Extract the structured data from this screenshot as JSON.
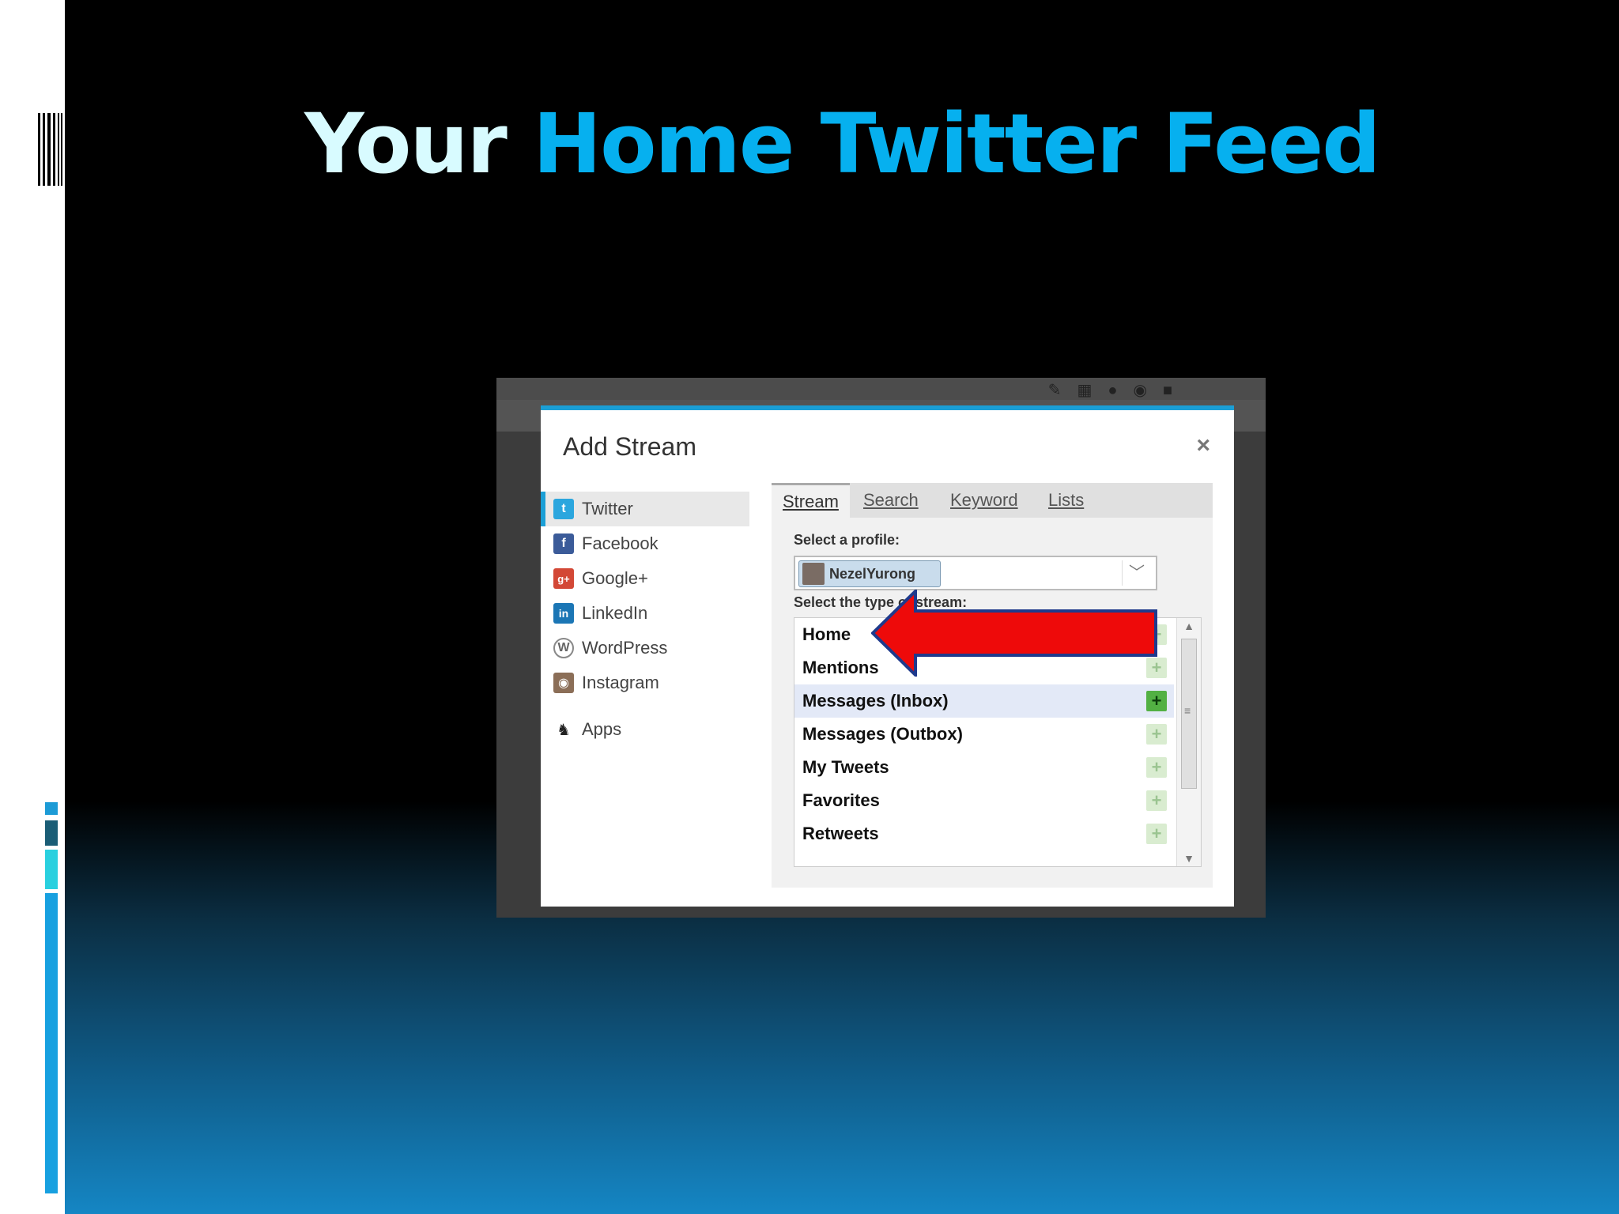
{
  "slide": {
    "title_part1": "Your",
    "title_part2": "Home Twitter Feed",
    "colors": {
      "title_part1": "#d8fbff",
      "title_part2": "#06b0ef",
      "background_top": "#000000",
      "background_bottom": "#1586c4"
    }
  },
  "screenshot": {
    "toolbar_icons": [
      "paperclip-icon",
      "calendar-icon",
      "location-pin-icon",
      "globe-icon",
      "lock-icon"
    ],
    "dialog": {
      "title": "Add Stream",
      "close_label": "×",
      "networks": [
        {
          "label": "Twitter",
          "icon": "twitter-icon",
          "active": true
        },
        {
          "label": "Facebook",
          "icon": "facebook-icon"
        },
        {
          "label": "Google+",
          "icon": "google-plus-icon"
        },
        {
          "label": "LinkedIn",
          "icon": "linkedin-icon"
        },
        {
          "label": "WordPress",
          "icon": "wordpress-icon"
        },
        {
          "label": "Instagram",
          "icon": "instagram-icon"
        },
        {
          "label": "Apps",
          "icon": "owl-icon"
        }
      ],
      "tabs": [
        {
          "label": "Stream",
          "active": true
        },
        {
          "label": "Search"
        },
        {
          "label": "Keyword"
        },
        {
          "label": "Lists"
        }
      ],
      "profile_label": "Select a profile:",
      "profile_value": "NezelYurong",
      "stream_type_label": "Select the type of stream:",
      "stream_types": [
        {
          "label": "Home"
        },
        {
          "label": "Mentions"
        },
        {
          "label": "Messages (Inbox)",
          "selected": true
        },
        {
          "label": "Messages (Outbox)"
        },
        {
          "label": "My Tweets"
        },
        {
          "label": "Favorites"
        },
        {
          "label": "Retweets"
        }
      ],
      "add_label": "+"
    }
  }
}
